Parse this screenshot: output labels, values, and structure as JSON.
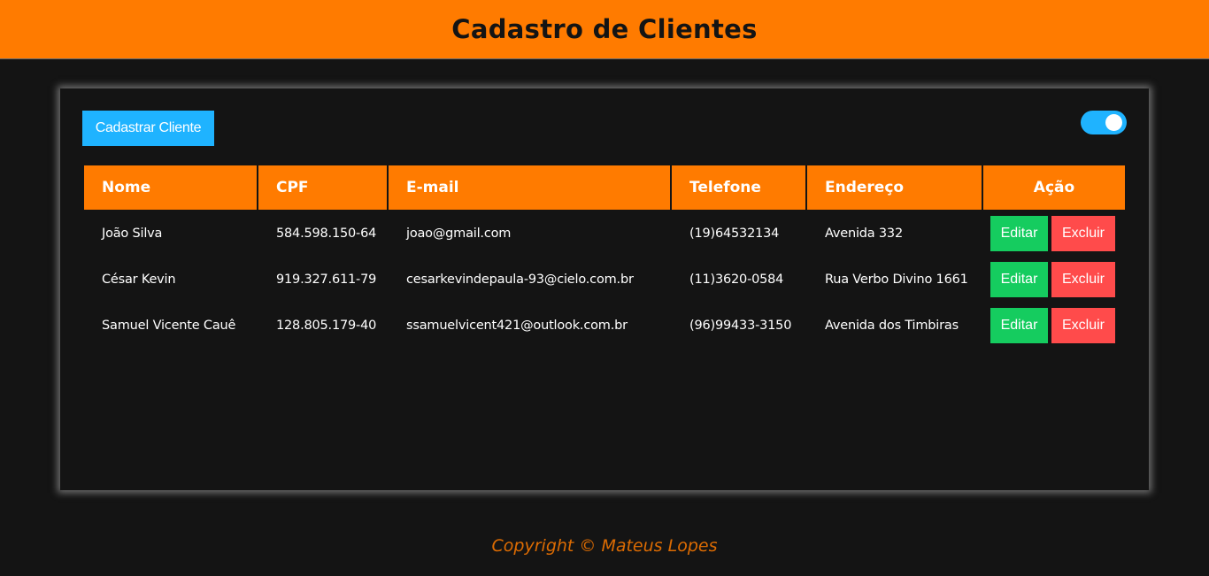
{
  "header": {
    "title": "Cadastro de Clientes"
  },
  "toolbar": {
    "new_client_label": "Cadastrar Cliente",
    "theme_toggle_on": true
  },
  "table": {
    "columns": [
      "Nome",
      "CPF",
      "E-mail",
      "Telefone",
      "Endereço",
      "Ação"
    ],
    "rows": [
      {
        "nome": "João Silva",
        "cpf": "584.598.150-64",
        "email": "joao@gmail.com",
        "telefone": "(19)64532134",
        "endereco": "Avenida 332"
      },
      {
        "nome": "César Kevin",
        "cpf": "919.327.611-79",
        "email": "cesarkevindepaula-93@cielo.com.br",
        "telefone": "(11)3620-0584",
        "endereco": "Rua Verbo Divino 1661"
      },
      {
        "nome": "Samuel Vicente Cauê",
        "cpf": "128.805.179-40",
        "email": "ssamuelvicent421@outlook.com.br",
        "telefone": "(96)99433-3150",
        "endereco": "Avenida dos Timbiras"
      }
    ],
    "edit_label": "Editar",
    "delete_label": "Excluir"
  },
  "footer": {
    "copyright": "Copyright © Mateus Lopes"
  },
  "colors": {
    "header_bg": "#ff7b00",
    "primary_button": "#1fb3ff",
    "edit_button": "#15cc5f",
    "delete_button": "#ff4b4b",
    "background": "#141414"
  }
}
